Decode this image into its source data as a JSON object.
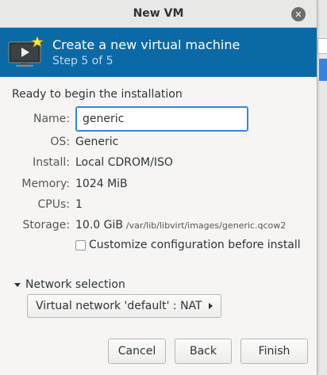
{
  "window": {
    "title": "New VM",
    "close_icon": "close-icon"
  },
  "banner": {
    "title": "Create a new virtual machine",
    "step": "Step 5 of 5",
    "icon": "vm-monitor-icon",
    "background_color": "#0b6aa6"
  },
  "summary": {
    "heading": "Ready to begin the installation",
    "name_label": "Name:",
    "name_value": "generic",
    "rows": [
      {
        "label": "OS:",
        "value": "Generic"
      },
      {
        "label": "Install:",
        "value": "Local CDROM/ISO"
      },
      {
        "label": "Memory:",
        "value": "1024 MiB"
      },
      {
        "label": "CPUs:",
        "value": "1"
      }
    ],
    "storage_label": "Storage:",
    "storage_size": "10.0 GiB",
    "storage_path": "/var/lib/libvirt/images/generic.qcow2",
    "customize_label": "Customize configuration before install",
    "customize_checked": false
  },
  "network": {
    "heading": "Network selection",
    "selected": "Virtual network 'default' : NAT"
  },
  "buttons": {
    "cancel": "Cancel",
    "back": "Back",
    "finish": "Finish"
  }
}
